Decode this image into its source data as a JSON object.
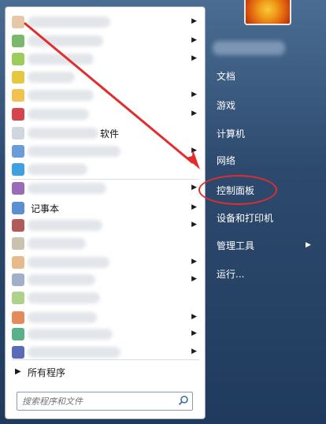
{
  "left_pane": {
    "programs": [
      {
        "label": "",
        "has_submenu": true,
        "color": "#e6c7a8"
      },
      {
        "label": "",
        "has_submenu": true,
        "color": "#7ab86b"
      },
      {
        "label": "",
        "has_submenu": true,
        "color": "#9ccd5a"
      },
      {
        "label": "",
        "has_submenu": false,
        "color": "#e6c740"
      },
      {
        "label": "",
        "has_submenu": true,
        "color": "#f2c14e"
      },
      {
        "label": "",
        "has_submenu": true,
        "color": "#d6454a"
      },
      {
        "label": "软件",
        "has_submenu": false,
        "color": "#cfd6df"
      },
      {
        "label": "",
        "has_submenu": true,
        "color": "#6b9bd8"
      },
      {
        "label": "",
        "has_submenu": false,
        "color": "#3fa0e0"
      },
      {
        "label": "",
        "has_submenu": true,
        "color": "#9a6bb8"
      },
      {
        "label": "记事本",
        "has_submenu": true,
        "color": "#5a8fd0"
      },
      {
        "label": "",
        "has_submenu": true,
        "color": "#b05a5a"
      },
      {
        "label": "",
        "has_submenu": false,
        "color": "#c9c2b0"
      },
      {
        "label": "",
        "has_submenu": true,
        "color": "#e8b98a"
      },
      {
        "label": "",
        "has_submenu": true,
        "color": "#9fb0c8"
      },
      {
        "label": "",
        "has_submenu": false,
        "color": "#aed28a"
      },
      {
        "label": "",
        "has_submenu": true,
        "color": "#e58a5a"
      },
      {
        "label": "",
        "has_submenu": true,
        "color": "#5ab08a"
      },
      {
        "label": "",
        "has_submenu": true,
        "color": "#5a6bb8"
      }
    ],
    "all_programs_label": "所有程序",
    "search_placeholder": "搜索程序和文件"
  },
  "right_pane": {
    "links": [
      {
        "label": "文档",
        "has_submenu": false
      },
      {
        "label": "游戏",
        "has_submenu": false
      },
      {
        "label": "计算机",
        "has_submenu": false
      },
      {
        "label": "网络",
        "has_submenu": false
      },
      {
        "label": "控制面板",
        "has_submenu": false
      },
      {
        "label": "设备和打印机",
        "has_submenu": false
      },
      {
        "label": "管理工具",
        "has_submenu": true
      },
      {
        "label": "运行...",
        "has_submenu": false
      }
    ]
  },
  "colors": {
    "annotation": "#e22d2d",
    "right_pane_bg": "#2d4a6e"
  }
}
